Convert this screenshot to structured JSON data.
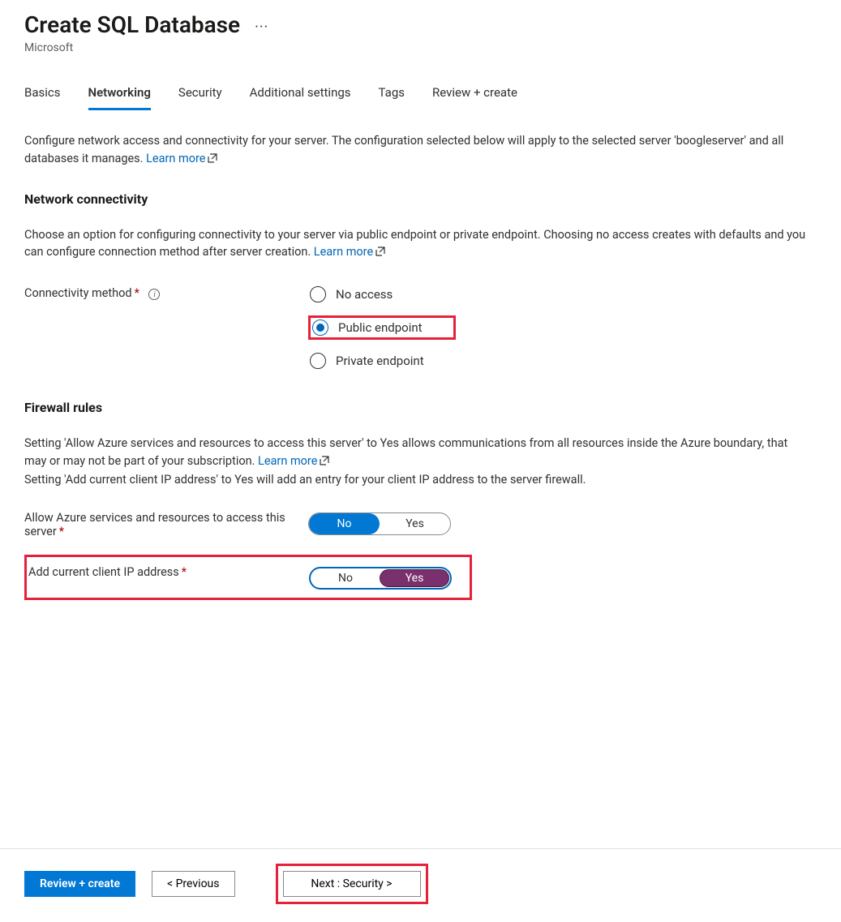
{
  "header": {
    "title": "Create SQL Database",
    "subtitle": "Microsoft"
  },
  "tabs": {
    "items": [
      {
        "label": "Basics",
        "active": false
      },
      {
        "label": "Networking",
        "active": true
      },
      {
        "label": "Security",
        "active": false
      },
      {
        "label": "Additional settings",
        "active": false
      },
      {
        "label": "Tags",
        "active": false
      },
      {
        "label": "Review + create",
        "active": false
      }
    ]
  },
  "intro": {
    "text": "Configure network access and connectivity for your server. The configuration selected below will apply to the selected server 'boogleserver' and all databases it manages. ",
    "learn_more": "Learn more"
  },
  "connectivity": {
    "heading": "Network connectivity",
    "description": "Choose an option for configuring connectivity to your server via public endpoint or private endpoint. Choosing no access creates with defaults and you can configure connection method after server creation. ",
    "learn_more": "Learn more",
    "method_label": "Connectivity method",
    "options": [
      {
        "label": "No access",
        "selected": false
      },
      {
        "label": "Public endpoint",
        "selected": true
      },
      {
        "label": "Private endpoint",
        "selected": false
      }
    ]
  },
  "firewall": {
    "heading": "Firewall rules",
    "desc1": "Setting 'Allow Azure services and resources to access this server' to Yes allows communications from all resources inside the Azure boundary, that may or may not be part of your subscription. ",
    "learn_more": "Learn more",
    "desc2": "Setting 'Add current client IP address' to Yes will add an entry for your client IP address to the server firewall.",
    "allow_azure_label": "Allow Azure services and resources to access this server",
    "allow_azure_value": "No",
    "add_ip_label": "Add current client IP address",
    "add_ip_value": "Yes",
    "toggle_no": "No",
    "toggle_yes": "Yes"
  },
  "footer": {
    "review": "Review + create",
    "previous": "< Previous",
    "next": "Next : Security >"
  }
}
